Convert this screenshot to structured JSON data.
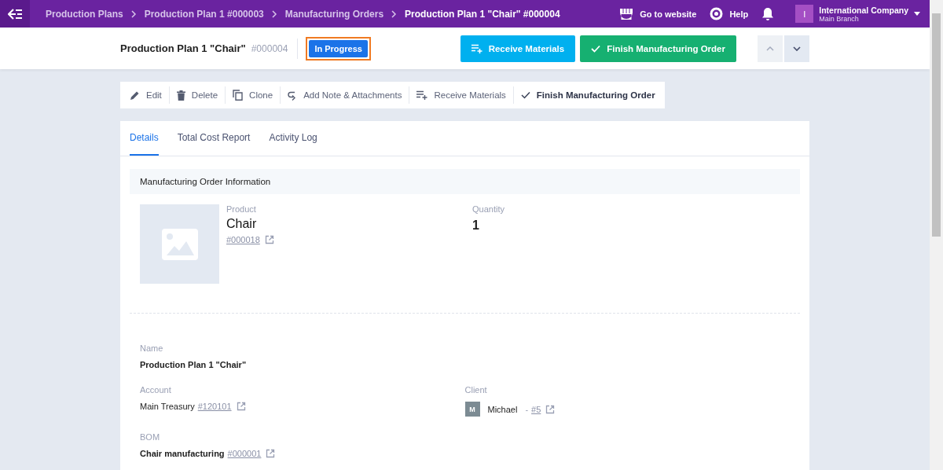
{
  "breadcrumbs": [
    {
      "label": "Production Plans",
      "current": false
    },
    {
      "label": "Production Plan 1 #000003",
      "current": false
    },
    {
      "label": "Manufacturing Orders",
      "current": false
    },
    {
      "label": "Production Plan 1 \"Chair\" #000004",
      "current": true
    }
  ],
  "topbar": {
    "website": "Go to website",
    "help": "Help",
    "company": "International Company",
    "branch": "Main Branch",
    "avatar": "I"
  },
  "header": {
    "title": "Production Plan 1 \"Chair\"",
    "number": "#000004",
    "status": "In Progress",
    "primary_buttons": [
      {
        "label": "Receive Materials",
        "kind": "info"
      },
      {
        "label": "Finish Manufacturing Order",
        "kind": "success"
      }
    ]
  },
  "toolbar": [
    {
      "label": "Edit",
      "kind": "edit"
    },
    {
      "label": "Delete",
      "kind": "delete"
    },
    {
      "label": "Clone",
      "kind": "clone"
    },
    {
      "label": "Add Note & Attachments",
      "kind": "note"
    },
    {
      "label": "Receive Materials",
      "kind": "receive"
    },
    {
      "label": "Finish Manufacturing Order",
      "kind": "finish"
    }
  ],
  "tabs": [
    {
      "label": "Details",
      "selected": true
    },
    {
      "label": "Total Cost Report",
      "selected": false
    },
    {
      "label": "Activity Log",
      "selected": false
    }
  ],
  "section_title": "Manufacturing Order Information",
  "product": {
    "label": "Product",
    "name": "Chair",
    "code": "#000018",
    "quantity_label": "Quantity",
    "quantity": "1"
  },
  "fields": [
    {
      "kind": "bold",
      "label": "Name",
      "value": "Production Plan 1 \"Chair\""
    },
    {
      "kind": "account",
      "label": "Account",
      "value": "Main Treasury",
      "link": "#120101"
    },
    {
      "kind": "client",
      "label": "Client",
      "avatar": "M",
      "value": "Michael",
      "separator": "-",
      "link": "#5"
    },
    {
      "kind": "bold_link",
      "label": "BOM",
      "value": "Chair manufacturing",
      "link": "#000001"
    }
  ]
}
